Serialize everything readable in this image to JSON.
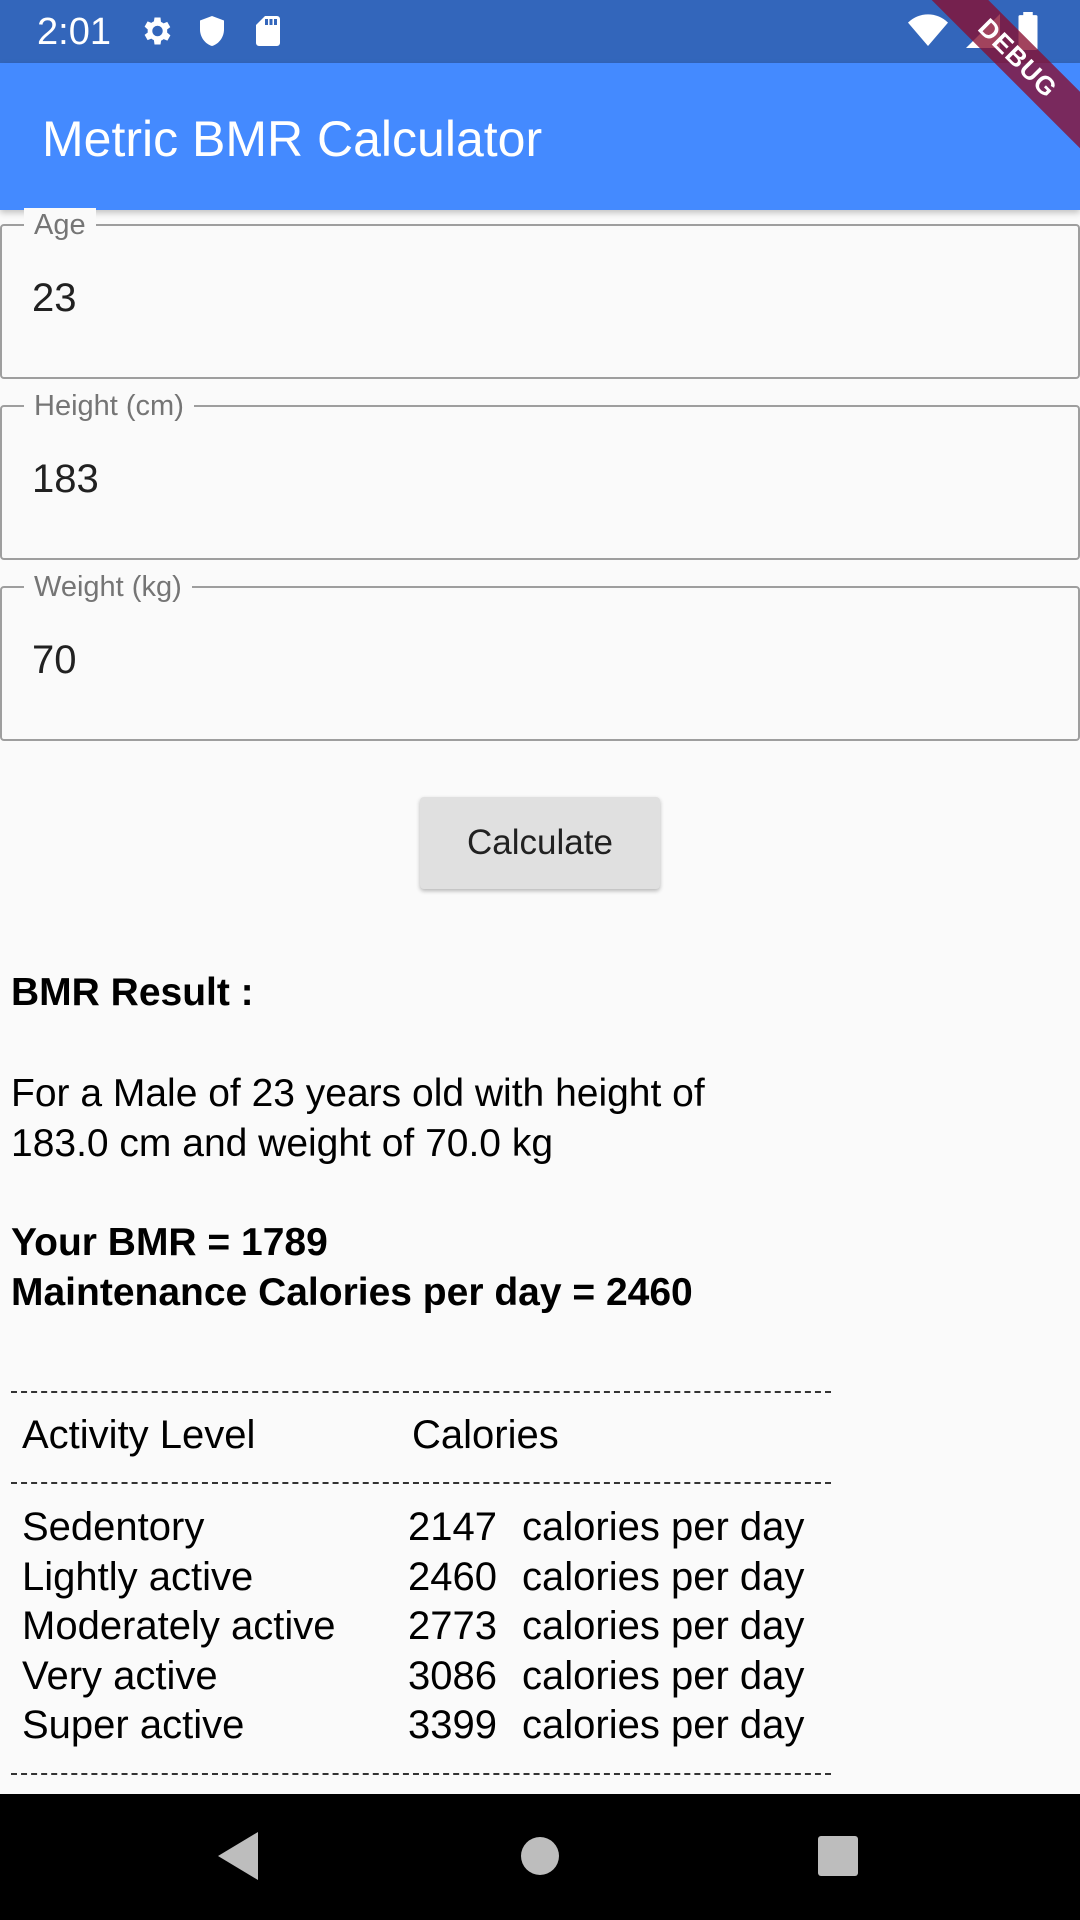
{
  "status_bar": {
    "time": "2:01",
    "left_icons": [
      "gear-icon",
      "shield-icon",
      "sd-card-icon"
    ],
    "right_icons": [
      "wifi-icon",
      "signal-icon",
      "battery-icon"
    ]
  },
  "debug_banner": "DEBUG",
  "app_bar": {
    "title": "Metric BMR Calculator"
  },
  "fields": [
    {
      "label": "Age",
      "value": "23"
    },
    {
      "label": "Height (cm)",
      "value": "183"
    },
    {
      "label": "Weight (kg)",
      "value": "70"
    }
  ],
  "calculate_button": {
    "label": "Calculate"
  },
  "result": {
    "heading": "BMR Result :",
    "description_line1": "For a Male of 23 years old with height of",
    "description_line2": "183.0 cm and weight of 70.0 kg",
    "bmr": "Your BMR = 1789",
    "maintenance": "Maintenance Calories per day = 2460"
  },
  "table": {
    "headers": {
      "activity": "Activity Level",
      "calories": "Calories"
    },
    "unit": "calories per day",
    "rows": [
      {
        "activity": "Sedentory",
        "calories": "2147"
      },
      {
        "activity": "Lightly active",
        "calories": "2460"
      },
      {
        "activity": "Moderately active",
        "calories": "2773"
      },
      {
        "activity": "Very active",
        "calories": "3086"
      },
      {
        "activity": "Super active",
        "calories": "3399"
      }
    ]
  },
  "nav_bar": [
    "back-icon",
    "home-icon",
    "recents-icon"
  ],
  "colors": {
    "status_bar": "#3366bb",
    "app_bar": "#448aff",
    "debug_ribbon": "#880e30"
  }
}
